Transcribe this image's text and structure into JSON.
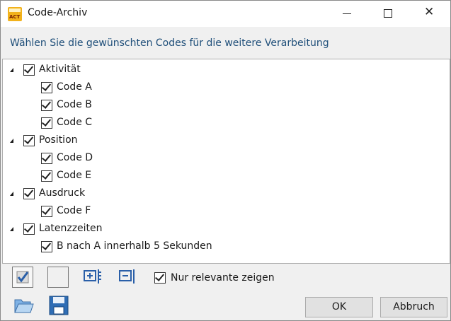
{
  "window": {
    "title": "Code-Archiv"
  },
  "instruction": "Wählen Sie die gewünschten Codes für die weitere Verarbeitung",
  "tree": [
    {
      "label": "Aktivität",
      "checked": true,
      "children": [
        {
          "label": "Code A",
          "checked": true
        },
        {
          "label": "Code B",
          "checked": true
        },
        {
          "label": "Code C",
          "checked": true
        }
      ]
    },
    {
      "label": "Position",
      "checked": true,
      "children": [
        {
          "label": "Code D",
          "checked": true
        },
        {
          "label": "Code E",
          "checked": true
        }
      ]
    },
    {
      "label": "Ausdruck",
      "checked": true,
      "children": [
        {
          "label": "Code F",
          "checked": true
        }
      ]
    },
    {
      "label": "Latenzzeiten",
      "checked": true,
      "children": [
        {
          "label": "B nach A innerhalb 5 Sekunden",
          "checked": true
        }
      ]
    }
  ],
  "toolbar": {
    "only_relevant_label": "Nur relevante zeigen",
    "only_relevant_checked": true
  },
  "buttons": {
    "ok": "OK",
    "cancel": "Abbruch"
  },
  "colors": {
    "instruction_text": "#1e4e79",
    "app_icon": "#f2b21b"
  }
}
